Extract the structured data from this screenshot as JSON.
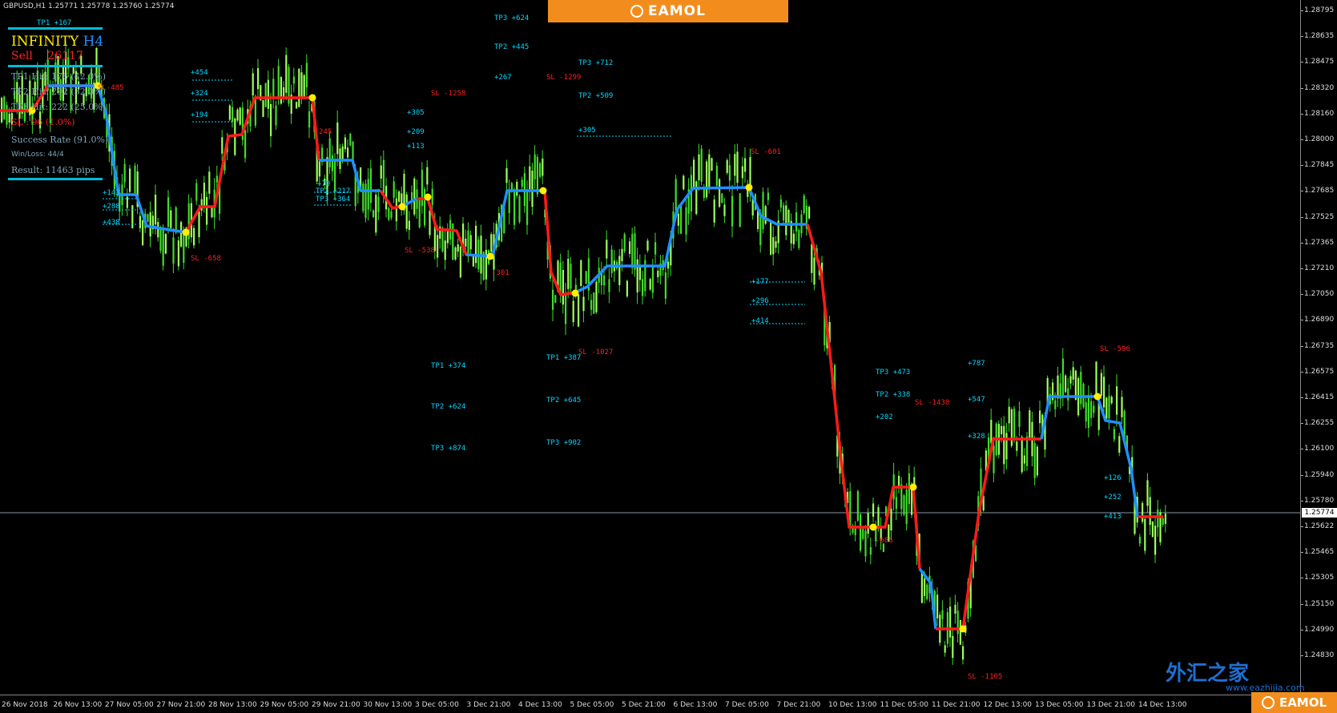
{
  "header": {
    "symbol_info": "GBPUSD,H1  1.25771 1.25778 1.25760 1.25774",
    "eamol_top": "EAMOL",
    "eamol_bottom": "EAMOL",
    "watermark": "外汇之家",
    "watermark_badge": "EA",
    "watermark_url": "www.eazhijia.com"
  },
  "info_panel": {
    "title": "INFINITY",
    "timeframe": "H4",
    "sell_label": "Sell",
    "sell_value": "26117",
    "tp1": "TP1 Hit: 176 (42.0%)",
    "tp2": "TP2 Hit: 292 (32.0%)",
    "tp3": "TP3 Hit: 222 (25.0%)",
    "sl": "SL : 96 (1.0%)",
    "success": "Success Rate (91.0%)",
    "winloss": "Win/Loss: 44/4",
    "result": "Result: 11463 pips"
  },
  "price_axis": {
    "labels": [
      "1.28795",
      "1.28635",
      "1.28475",
      "1.28320",
      "1.28160",
      "1.28000",
      "1.27845",
      "1.27685",
      "1.27525",
      "1.27365",
      "1.27210",
      "1.27050",
      "1.26890",
      "1.26735",
      "1.26575",
      "1.26415",
      "1.26255",
      "1.26100",
      "1.25940",
      "1.25780",
      "1.25622",
      "1.25465",
      "1.25305",
      "1.25150",
      "1.24990",
      "1.24830"
    ],
    "current": "1.25774"
  },
  "time_axis": {
    "labels": [
      "26 Nov 2018",
      "26 Nov 13:00",
      "27 Nov 05:00",
      "27 Nov 21:00",
      "28 Nov 13:00",
      "29 Nov 05:00",
      "29 Nov 21:00",
      "30 Nov 13:00",
      "3 Dec 05:00",
      "3 Dec 21:00",
      "4 Dec 13:00",
      "5 Dec 05:00",
      "5 Dec 21:00",
      "6 Dec 13:00",
      "7 Dec 05:00",
      "7 Dec 21:00",
      "10 Dec 13:00",
      "11 Dec 05:00",
      "11 Dec 21:00",
      "12 Dec 13:00",
      "13 Dec 05:00",
      "13 Dec 21:00",
      "14 Dec 13:00"
    ]
  },
  "labels": [
    {
      "t": "TP1 +167",
      "c": "cy"
    },
    {
      "t": "SL-485",
      "c": "rd"
    },
    {
      "t": "+454",
      "c": "cy"
    },
    {
      "t": "+324",
      "c": "cy"
    },
    {
      "t": "+194",
      "c": "cy"
    },
    {
      "t": "+143",
      "c": "cy"
    },
    {
      "t": "+288",
      "c": "cy"
    },
    {
      "t": "+438",
      "c": "cy"
    },
    {
      "t": "SL -658",
      "c": "rd"
    },
    {
      "t": "TP3 +624",
      "c": "cy"
    },
    {
      "t": "TP2 +445",
      "c": "cy"
    },
    {
      "t": "+267",
      "c": "cy"
    },
    {
      "t": "SL -1299",
      "c": "rd"
    },
    {
      "t": "TP3 +712",
      "c": "cy"
    },
    {
      "t": "TP2 +509",
      "c": "cy"
    },
    {
      "t": "+305",
      "c": "cy"
    },
    {
      "t": "SL -1258",
      "c": "rd"
    },
    {
      "t": "+305",
      "c": "cy"
    },
    {
      "t": "+209",
      "c": "cy"
    },
    {
      "t": "+113",
      "c": "cy"
    },
    {
      "t": "245",
      "c": "rd"
    },
    {
      "t": "+70",
      "c": "cy"
    },
    {
      "t": "TP2 +217",
      "c": "cy"
    },
    {
      "t": "TP3 +364",
      "c": "cy"
    },
    {
      "t": "SL -538",
      "c": "rd"
    },
    {
      "t": "-301",
      "c": "rd"
    },
    {
      "t": "SL -601",
      "c": "rd"
    },
    {
      "t": "+177",
      "c": "cy"
    },
    {
      "t": "+296",
      "c": "cy"
    },
    {
      "t": "+414",
      "c": "cy"
    },
    {
      "t": "TP1 +374",
      "c": "cy"
    },
    {
      "t": "TP2 +624",
      "c": "cy"
    },
    {
      "t": "TP3 +874",
      "c": "cy"
    },
    {
      "t": "TP1 +387",
      "c": "cy"
    },
    {
      "t": "SL -1027",
      "c": "rd"
    },
    {
      "t": "TP2 +645",
      "c": "cy"
    },
    {
      "t": "TP3 +902",
      "c": "cy"
    },
    {
      "t": "TP3 +473",
      "c": "cy"
    },
    {
      "t": "TP2 +338",
      "c": "cy"
    },
    {
      "t": "SL -1430",
      "c": "rd"
    },
    {
      "t": "+202",
      "c": "cy"
    },
    {
      "t": "-686",
      "c": "rd"
    },
    {
      "t": "+787",
      "c": "cy"
    },
    {
      "t": "+547",
      "c": "cy"
    },
    {
      "t": "+328",
      "c": "cy"
    },
    {
      "t": "SL -1105",
      "c": "rd"
    },
    {
      "t": "SL -596",
      "c": "rd"
    },
    {
      "t": "+126",
      "c": "cy"
    },
    {
      "t": "+252",
      "c": "cy"
    },
    {
      "t": "+413",
      "c": "cy"
    }
  ],
  "colors": {
    "candle": "#3fdc2a",
    "buy_line": "#1e90ff",
    "sell_line": "#ff1a1a",
    "dot": "#ffee00",
    "cyan": "#00d8ff"
  }
}
